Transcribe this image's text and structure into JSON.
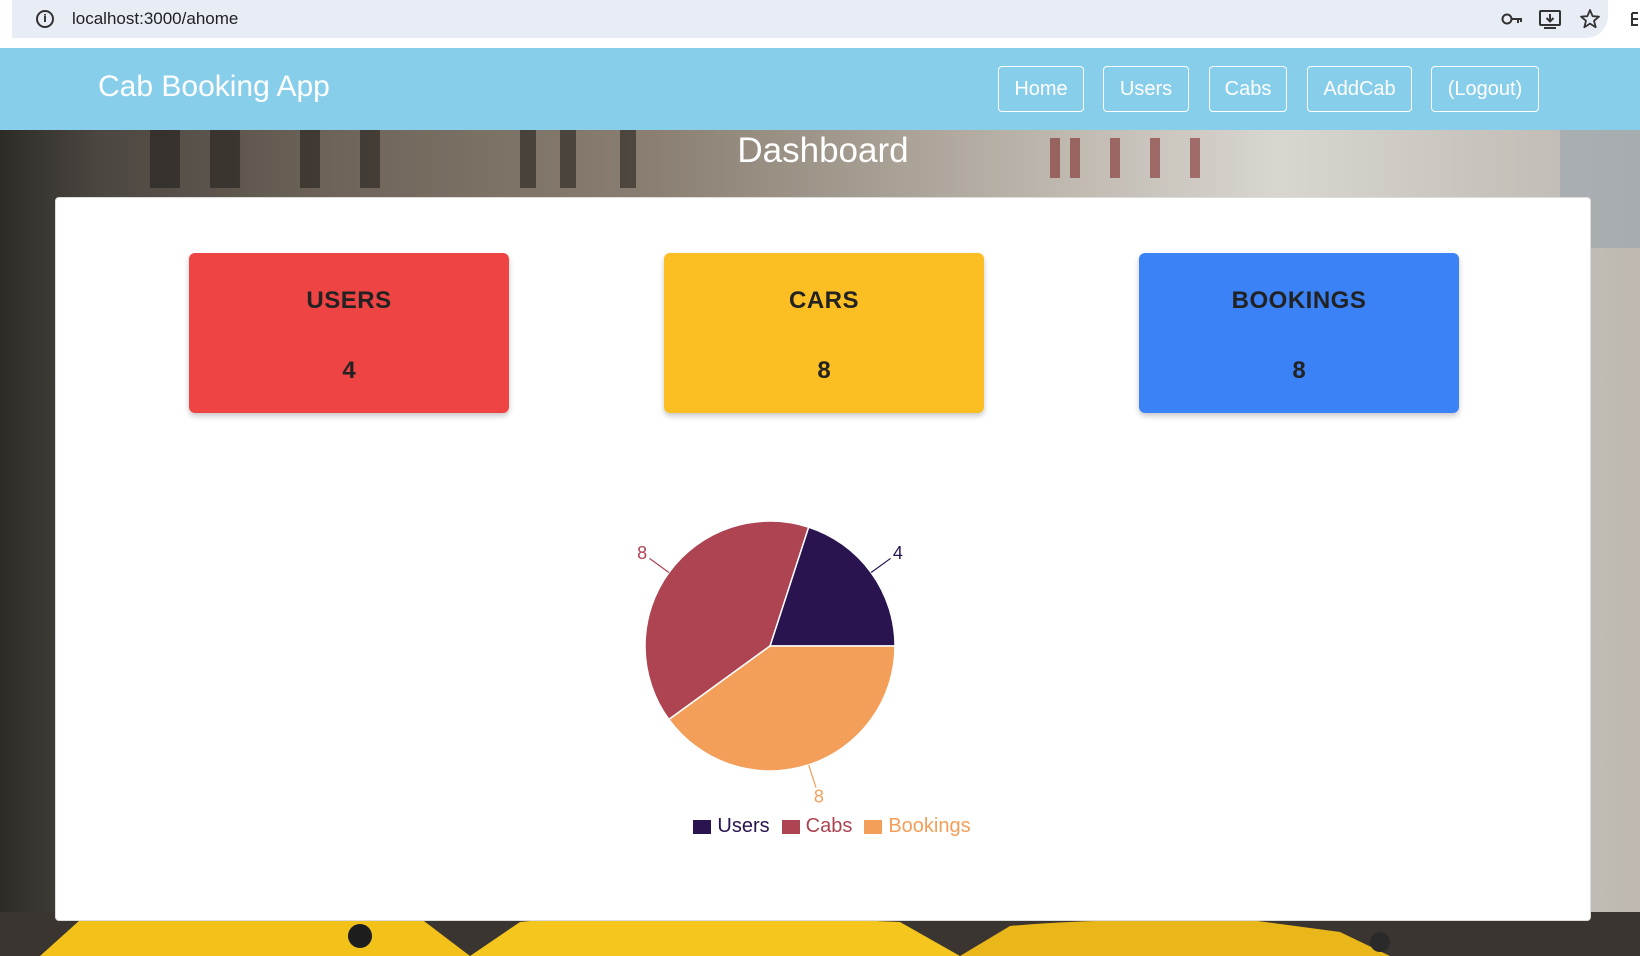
{
  "browser": {
    "url": "localhost:3000/ahome",
    "info_glyph": "i"
  },
  "navbar": {
    "brand": "Cab Booking App",
    "links": [
      "Home",
      "Users",
      "Cabs",
      "AddCab",
      "(Logout)"
    ]
  },
  "page_title": "Dashboard",
  "stats": [
    {
      "label": "USERS",
      "value": "4",
      "color": "#ef4444"
    },
    {
      "label": "CARS",
      "value": "8",
      "color": "#fbbf24"
    },
    {
      "label": "BOOKINGS",
      "value": "8",
      "color": "#3b82f6"
    }
  ],
  "chart_data": {
    "type": "pie",
    "categories": [
      "Users",
      "Cabs",
      "Bookings"
    ],
    "values": [
      4,
      8,
      8
    ],
    "colors": [
      "#2a1450",
      "#ae4352",
      "#f39f5a"
    ],
    "data_labels": [
      "4",
      "8",
      "8"
    ],
    "legend_position": "bottom"
  },
  "icons": [
    "info-icon",
    "key-icon",
    "install-icon",
    "star-icon"
  ]
}
